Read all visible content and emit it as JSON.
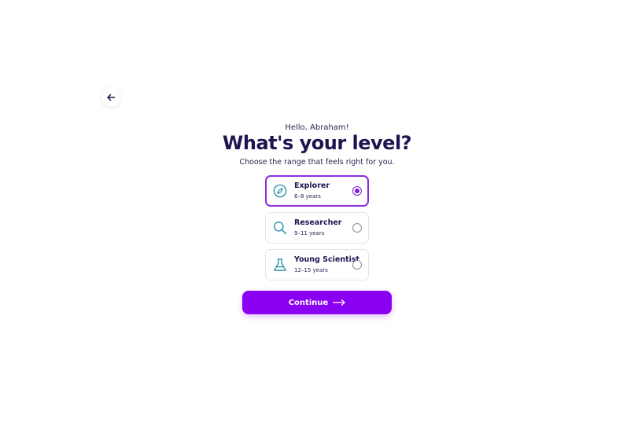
{
  "header": {
    "back_icon": "arrow-left-icon"
  },
  "greeting": "Hello, Abraham!",
  "title": "What's your level?",
  "subtitle": "Choose the range that feels right for you.",
  "options": [
    {
      "name": "Explorer",
      "range": "6–8 years",
      "icon": "compass-icon",
      "selected": true
    },
    {
      "name": "Researcher",
      "range": "9–11 years",
      "icon": "magnifier-icon",
      "selected": false
    },
    {
      "name": "Young Scientist",
      "range": "12–15 years",
      "icon": "flask-icon",
      "selected": false
    }
  ],
  "continue_button": {
    "label": "Continue",
    "icon": "arrow-right-icon"
  },
  "colors": {
    "accent": "#8a00f0",
    "selected_border": "#8a2be2",
    "icon_teal": "#1e8fa8",
    "heading": "#1e1450"
  }
}
